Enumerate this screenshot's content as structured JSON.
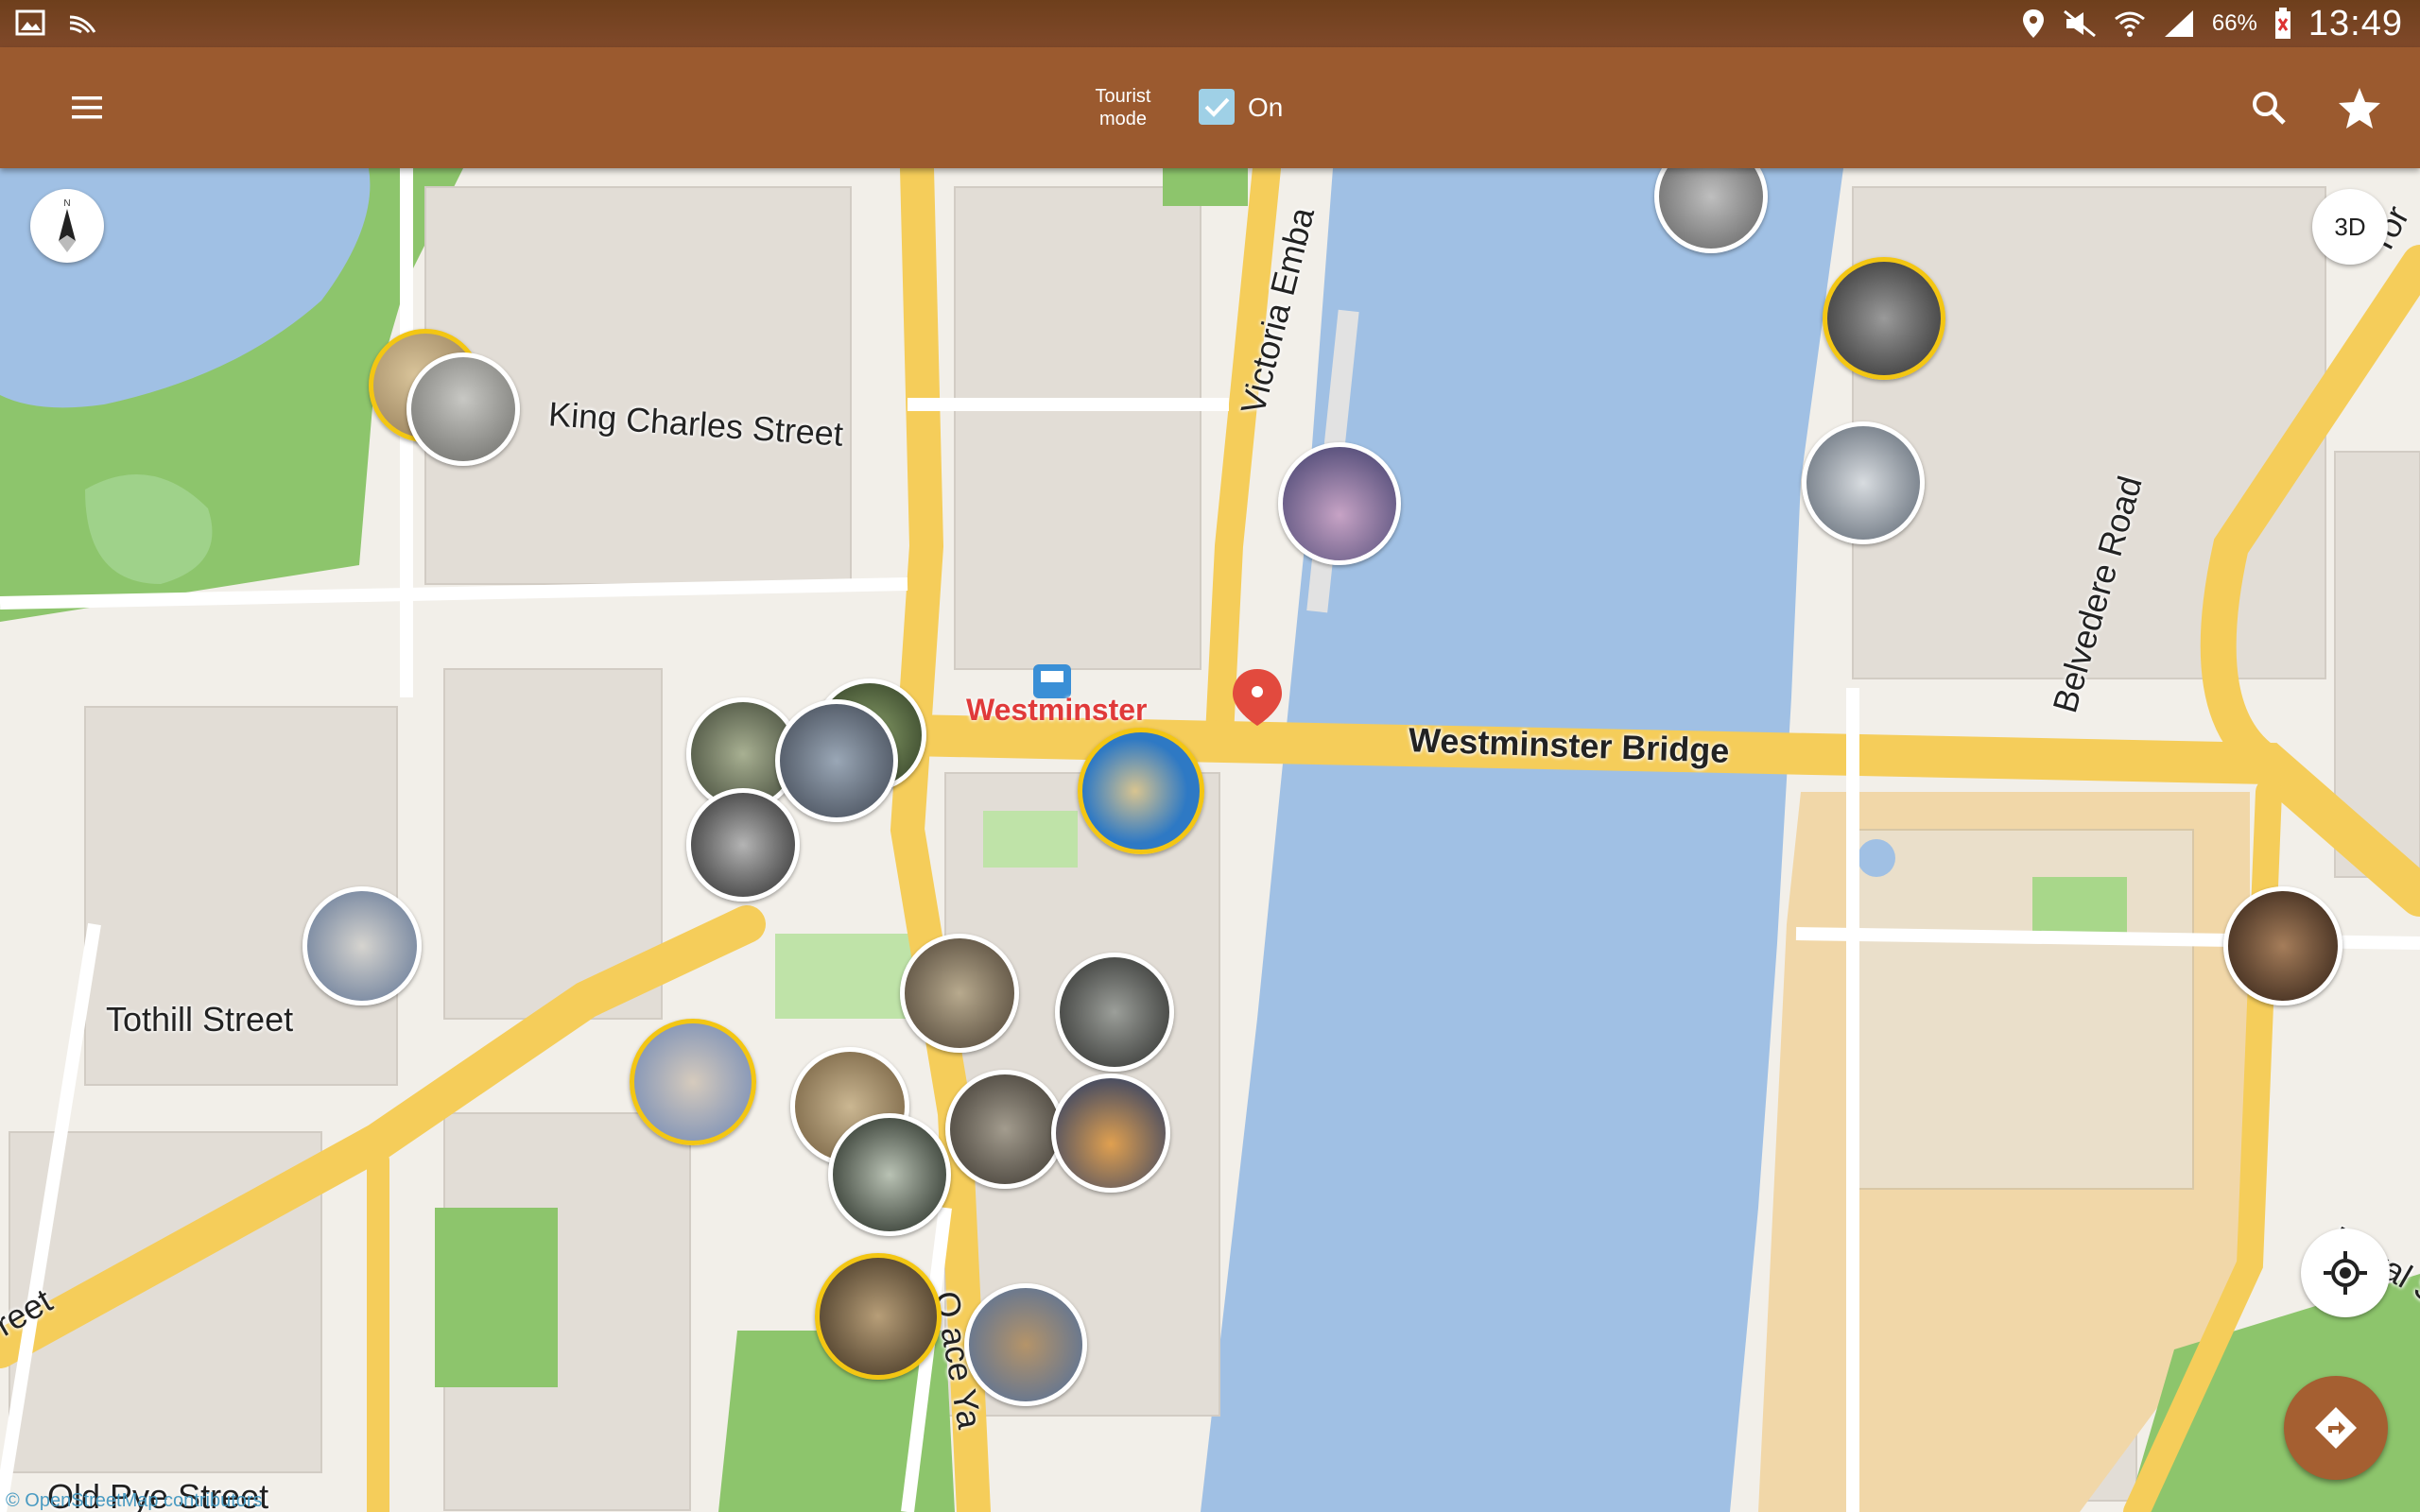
{
  "status_bar": {
    "battery": "66%",
    "time": "13:49"
  },
  "toolbar": {
    "menu_icon": "hamburger-menu-icon",
    "tourist_mode_label": "Tourist mode",
    "tourist_mode_checked": true,
    "tourist_mode_value": "On",
    "search_icon": "search-icon",
    "favorites_icon": "star-icon"
  },
  "map": {
    "street_labels": {
      "king_charles": "King Charles Street",
      "victoria_emb": "Victoria Emba",
      "westminster_bridge": "Westminster Bridge",
      "belvedere": "Belvedere Road",
      "tothill": "Tothill Street",
      "york": "Yor",
      "royal": "Royal S",
      "reet": "reet",
      "old_pye": "Old Pye Street",
      "palace_yard": "O ace Ya"
    },
    "station_label": "Westminster",
    "button_3d": "3D",
    "attribution": "© OpenStreetMap contributors",
    "colors": {
      "water": "#a0c0e4",
      "park": "#8dc56c",
      "road": "#f5cd5a",
      "building": "#e2ddd6",
      "poi_gold_border": "#f3c613",
      "toolbar": "#9b5a2f",
      "accent_marker": "#e24a3e"
    },
    "poi_count": 24
  }
}
